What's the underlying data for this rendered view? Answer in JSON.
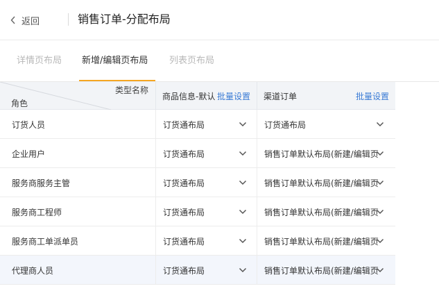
{
  "header": {
    "back_label": "返回",
    "title": "销售订单-分配布局"
  },
  "tabs": [
    {
      "label": "详情页布局",
      "active": false
    },
    {
      "label": "新增/编辑页布局",
      "active": true
    },
    {
      "label": "列表页布局",
      "active": false
    }
  ],
  "table": {
    "header": {
      "diag_top": "类型名称",
      "diag_bottom": "角色",
      "goods_label": "商品信息-默认...",
      "goods_batch": "批量设置",
      "channel_label": "渠道订单",
      "channel_batch": "批量设置"
    },
    "rows": [
      {
        "role": "订货人员",
        "goods": "订货通布局",
        "channel": "订货通布局"
      },
      {
        "role": "企业用户",
        "goods": "订货通布局",
        "channel": "销售订单默认布局(新建/编辑页)"
      },
      {
        "role": "服务商服务主管",
        "goods": "订货通布局",
        "channel": "销售订单默认布局(新建/编辑页)"
      },
      {
        "role": "服务商工程师",
        "goods": "订货通布局",
        "channel": "销售订单默认布局(新建/编辑页)"
      },
      {
        "role": "服务商工单派单员",
        "goods": "订货通布局",
        "channel": "销售订单默认布局(新建/编辑页)"
      },
      {
        "role": "代理商人员",
        "goods": "订货通布局",
        "channel": "销售订单默认布局(新建/编辑页)"
      }
    ]
  },
  "colors": {
    "accent": "#f5a623",
    "link": "#3a7bd5",
    "header_bg": "#f2f4f7",
    "highlight_row": "#f3f6fc"
  }
}
